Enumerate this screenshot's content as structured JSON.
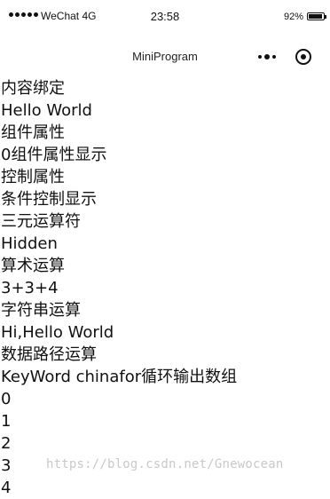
{
  "status_bar": {
    "carrier": "WeChat 4G",
    "time": "23:58",
    "battery_percent": "92%"
  },
  "nav_bar": {
    "title": "MiniProgram"
  },
  "content": {
    "lines": [
      "内容绑定",
      "Hello World",
      "组件属性",
      "0组件属性显示",
      "控制属性",
      "条件控制显示",
      "三元运算符",
      "Hidden",
      "算术运算",
      "3+3+4",
      "字符串运算",
      "Hi,Hello World",
      "数据路径运算",
      "KeyWord chinafor循环输出数组",
      "0",
      "1",
      "2",
      "3",
      "4"
    ]
  },
  "watermark": "https://blog.csdn.net/Gnewocean"
}
